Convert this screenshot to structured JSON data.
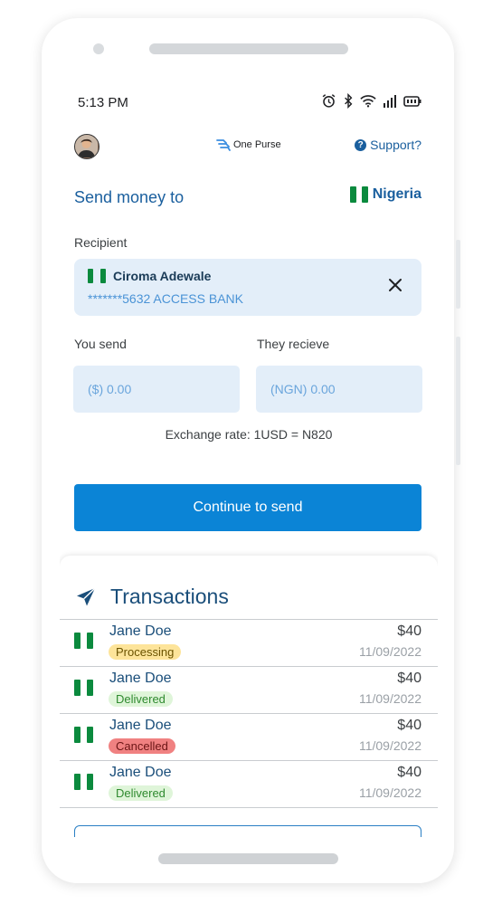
{
  "status_bar": {
    "time": "5:13 PM"
  },
  "header": {
    "brand": "One Purse",
    "support_label": "Support?"
  },
  "send": {
    "title": "Send money to",
    "country": "Nigeria",
    "recipient_label": "Recipient",
    "recipient": {
      "name": "Ciroma Adewale",
      "account": "*******5632 ACCESS BANK"
    },
    "you_send_label": "You send",
    "they_receive_label": "They recieve",
    "you_send_placeholder": "($) 0.00",
    "they_receive_placeholder": "(NGN) 0.00",
    "exchange_rate": "Exchange rate: 1USD = N820",
    "continue_label": "Continue to send"
  },
  "transactions": {
    "title": "Transactions",
    "items": [
      {
        "name": "Jane Doe",
        "status": "Processing",
        "amount": "$40",
        "date": "11/09/2022",
        "status_color": "#fde49a",
        "status_text_color": "#6b5300"
      },
      {
        "name": "Jane Doe",
        "status": "Delivered",
        "amount": "$40",
        "date": "11/09/2022",
        "status_color": "#dff5d9",
        "status_text_color": "#2f8a2f"
      },
      {
        "name": "Jane Doe",
        "status": "Cancelled",
        "amount": "$40",
        "date": "11/09/2022",
        "status_color": "#f08181",
        "status_text_color": "#6b1515"
      },
      {
        "name": "Jane Doe",
        "status": "Delivered",
        "amount": "$40",
        "date": "11/09/2022",
        "status_color": "#dff5d9",
        "status_text_color": "#2f8a2f"
      }
    ]
  },
  "colors": {
    "primary": "#0b84d6",
    "accent_text": "#1a5f9e",
    "nigeria_green": "#0b8a3e"
  }
}
